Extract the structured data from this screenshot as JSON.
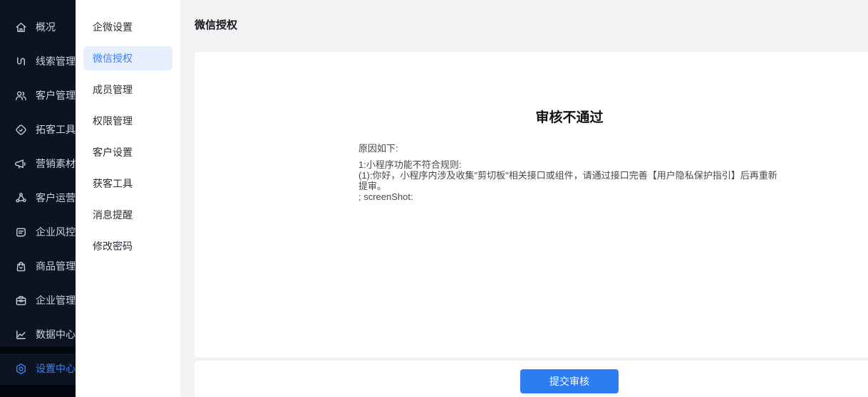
{
  "colors": {
    "accent_blue": "#3d80f8",
    "button_blue": "#2e7cf1",
    "primary_sidebar_bg": "#0c1322",
    "active_pill_bg": "#e7f0fe",
    "main_bg": "#f1f2f4"
  },
  "primary_sidebar": {
    "items": [
      {
        "label": "概况",
        "icon": "home-icon",
        "active": false
      },
      {
        "label": "线索管理",
        "icon": "clue-thread-icon",
        "active": false
      },
      {
        "label": "客户管理",
        "icon": "customers-icon",
        "active": false
      },
      {
        "label": "拓客工具",
        "icon": "expand-tools-icon",
        "active": false
      },
      {
        "label": "营销素材",
        "icon": "megaphone-icon",
        "active": false
      },
      {
        "label": "客户运营",
        "icon": "network-icon",
        "active": false
      },
      {
        "label": "企业风控",
        "icon": "risk-doc-icon",
        "active": false
      },
      {
        "label": "商品管理",
        "icon": "shopping-bag-icon",
        "active": false
      },
      {
        "label": "企业管理",
        "icon": "briefcase-icon",
        "active": false
      },
      {
        "label": "数据中心",
        "icon": "chart-icon",
        "active": false
      },
      {
        "label": "设置中心",
        "icon": "gear-icon",
        "active": true
      }
    ]
  },
  "secondary_sidebar": {
    "items": [
      {
        "label": "企微设置",
        "active": false
      },
      {
        "label": "微信授权",
        "active": true
      },
      {
        "label": "成员管理",
        "active": false
      },
      {
        "label": "权限管理",
        "active": false
      },
      {
        "label": "客户设置",
        "active": false
      },
      {
        "label": "获客工具",
        "active": false
      },
      {
        "label": "消息提醒",
        "active": false
      },
      {
        "label": "修改密码",
        "active": false
      }
    ]
  },
  "header": {
    "title": "微信授权"
  },
  "content": {
    "result_title": "审核不通过",
    "reason_intro": "原因如下:",
    "reason_lines": [
      "1:小程序功能不符合规则:",
      "(1):你好，小程序内涉及收集\"剪切板\"相关接口或组件，请通过接口完善【用户隐私保护指引】后再重新提审。",
      "; screenShot:"
    ],
    "submit_button": "提交审核"
  }
}
